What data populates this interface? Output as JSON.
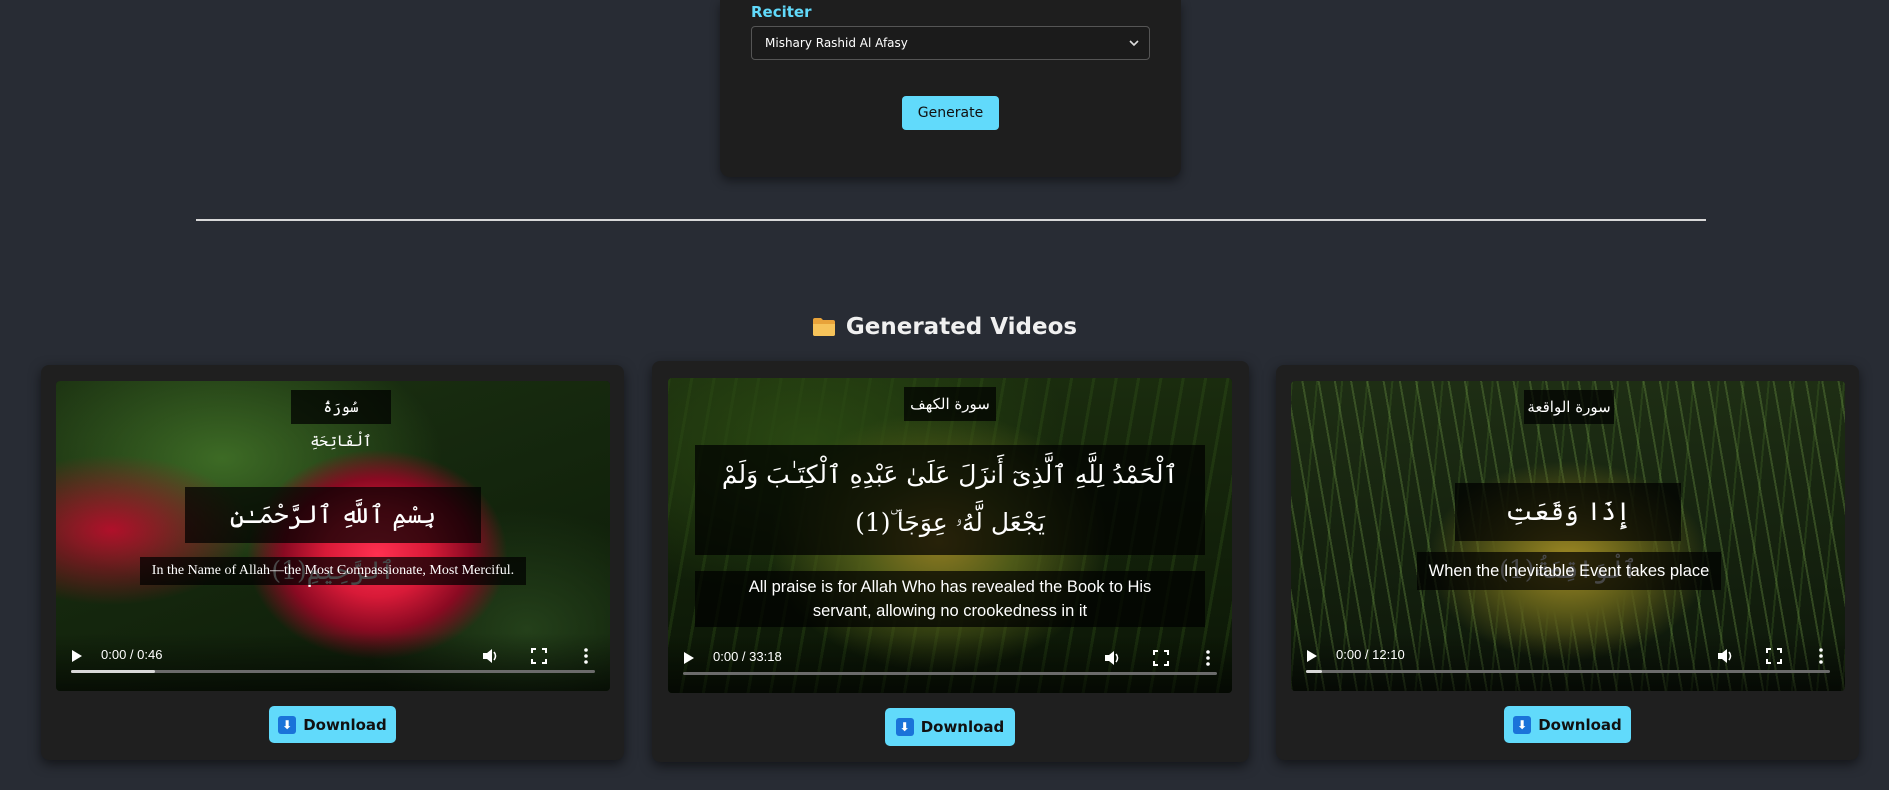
{
  "form": {
    "reciter_label": "Reciter",
    "reciter_selected": "Mishary Rashid Al Afasy",
    "generate_label": "Generate"
  },
  "section": {
    "icon": "folder-icon",
    "title": "Generated Videos"
  },
  "videos": [
    {
      "surah_title": "سُورَةُ ٱلْفَاتِحَةِ",
      "arabic_lines": [
        "بِسْمِ ٱللَّهِ ٱلرَّحْمَـٰنِ ٱلرَّحِيمِ(1)"
      ],
      "translation_lines": [
        "In the Name of Allah—the Most Compassionate, Most Merciful."
      ],
      "time": "0:00 / 0:46",
      "progress": 0.16,
      "download_label": "Download"
    },
    {
      "surah_title": "سورة الكهف",
      "arabic_lines": [
        "ٱلْحَمْدُ لِلَّهِ ٱلَّذِىٓ أَنزَلَ عَلَىٰ عَبْدِهِ ٱلْكِتَـٰبَ وَلَمْ",
        "يَجْعَل لَّهُۥ عِوَجَا ۜ(1)"
      ],
      "translation_lines": [
        "All praise is for Allah Who has revealed the Book to His",
        "servant, allowing no crookedness in it"
      ],
      "time": "0:00 / 33:18",
      "progress": 0.0,
      "download_label": "Download"
    },
    {
      "surah_title": "سورة الواقعة",
      "arabic_lines": [
        "إِذَا وَقَعَتِ ٱلْوَاقِعَةُ(1)"
      ],
      "translation_lines": [
        "When the Inevitable Event takes place"
      ],
      "time": "0:00 / 12:10",
      "progress": 0.03,
      "download_label": "Download"
    }
  ]
}
